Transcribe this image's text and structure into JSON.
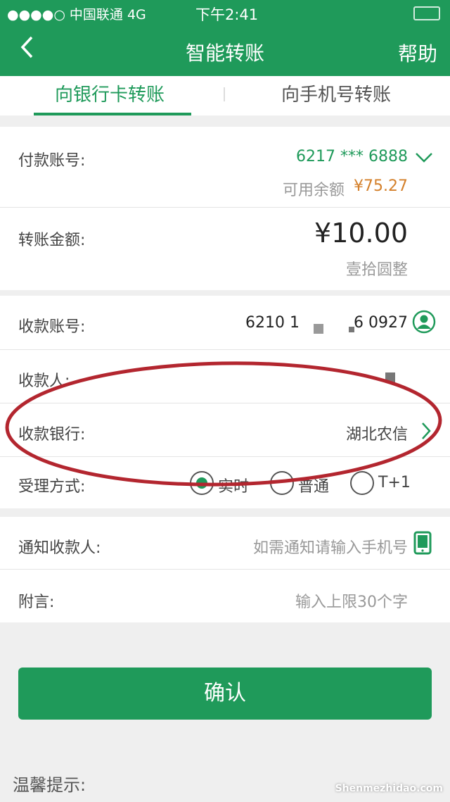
{
  "status_bar": {
    "carrier": "●●●●○ 中国联通  4G",
    "time": "下午2:41"
  },
  "nav": {
    "back": "<",
    "title": "智能转账",
    "help": "帮助"
  },
  "tabs": [
    {
      "label": "向银行卡转账",
      "active": true
    },
    {
      "label": "向手机号转账",
      "active": false
    }
  ],
  "payer": {
    "label": "付款账号:",
    "account": "6217 *** 6888",
    "balance_label": "可用余额",
    "balance": "¥75.27"
  },
  "amount": {
    "label": "转账金额:",
    "value": "¥10.00",
    "in_words": "壹拾圆整"
  },
  "payee": {
    "account_label": "收款账号:",
    "account_value": "6210 1",
    "account_tail": "6 0927",
    "name_label": "收款人:",
    "bank_label": "收款银行:",
    "bank_value": "湖北农信",
    "mode_label": "受理方式:",
    "modes": [
      {
        "label": "实时",
        "selected": true
      },
      {
        "label": "普通",
        "selected": false
      },
      {
        "label": "T+1",
        "selected": false
      }
    ]
  },
  "notify": {
    "label": "通知收款人:",
    "placeholder": "如需通知请输入手机号"
  },
  "memo": {
    "label": "附言:",
    "placeholder": "输入上限30个字"
  },
  "confirm_label": "确认",
  "tips_title": "温馨提示:",
  "watermark": "Shenmezhidao.com",
  "colors": {
    "brand": "#1f9a5a",
    "balance": "#d4802b",
    "annotation": "#b3262f"
  },
  "icons": [
    "back-icon",
    "chevron-down-icon",
    "contact-icon",
    "chevron-right-icon",
    "phone-icon"
  ]
}
